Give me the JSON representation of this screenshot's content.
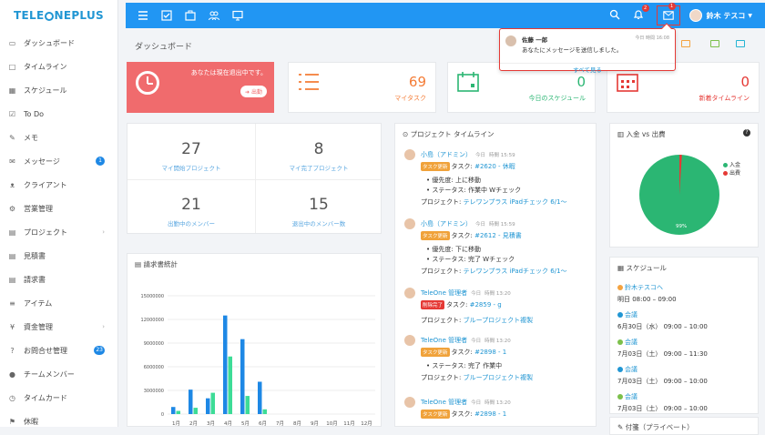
{
  "logo": {
    "text_before": "TELE",
    "text_after": "NEPLUS"
  },
  "sidebar": {
    "items": [
      {
        "label": "ダッシュボード",
        "icon": "monitor-icon"
      },
      {
        "label": "タイムライン",
        "icon": "square-icon"
      },
      {
        "label": "スケジュール",
        "icon": "calendar-icon"
      },
      {
        "label": "To Do",
        "icon": "checkbox-icon"
      },
      {
        "label": "メモ",
        "icon": "edit-icon"
      },
      {
        "label": "メッセージ",
        "icon": "envelope-icon",
        "badge": "1"
      },
      {
        "label": "クライアント",
        "icon": "handshake-icon"
      },
      {
        "label": "営業管理",
        "icon": "gears-icon"
      },
      {
        "label": "プロジェクト",
        "icon": "folder-icon",
        "chevron": true
      },
      {
        "label": "見積書",
        "icon": "document-icon"
      },
      {
        "label": "請求書",
        "icon": "invoice-icon"
      },
      {
        "label": "アイテム",
        "icon": "list-icon"
      },
      {
        "label": "資金管理",
        "icon": "yen-icon",
        "chevron": true
      },
      {
        "label": "お問合せ管理",
        "icon": "question-icon",
        "badge": "23"
      },
      {
        "label": "チームメンバー",
        "icon": "user-icon"
      },
      {
        "label": "タイムカード",
        "icon": "clock-icon"
      },
      {
        "label": "休暇",
        "icon": "leave-icon"
      }
    ]
  },
  "topbar": {
    "notif_badge": "2",
    "mail_badge": "1",
    "user_name": "鈴木 テスコ"
  },
  "page_title": "ダッシュボード",
  "away_card": {
    "text": "あなたは現在退出中です。",
    "button": "出勤"
  },
  "stats": [
    {
      "value": "69",
      "label": "マイタスク",
      "color": "#f47c36"
    },
    {
      "value": "0",
      "label": "今日のスケジュール",
      "color": "#2bb673"
    },
    {
      "value": "0",
      "label": "新着タイムライン",
      "color": "#e53935"
    }
  ],
  "counts": [
    {
      "value": "27",
      "label": "マイ開始プロジェクト"
    },
    {
      "value": "8",
      "label": "マイ完了プロジェクト"
    },
    {
      "value": "21",
      "label": "出勤中のメンバー"
    },
    {
      "value": "15",
      "label": "退出中のメンバー数"
    }
  ],
  "invoice_chart": {
    "title": "請求書統計"
  },
  "chart_data": {
    "type": "bar",
    "categories": [
      "1月",
      "2月",
      "3月",
      "4月",
      "5月",
      "6月",
      "7月",
      "8月",
      "9月",
      "10月",
      "11月",
      "12月"
    ],
    "series": [
      {
        "color": "#1e88e5",
        "values": [
          900000,
          3100000,
          2000000,
          12500000,
          9500000,
          4100000,
          0,
          0,
          0,
          0,
          0,
          0
        ]
      },
      {
        "color": "#3ddc97",
        "values": [
          400000,
          800000,
          2700000,
          7300000,
          2300000,
          600000,
          0,
          0,
          0,
          0,
          0,
          0
        ]
      }
    ],
    "yticks": [
      "0",
      "3000000",
      "6000000",
      "9000000",
      "12000000",
      "15000000"
    ],
    "ylim": [
      0,
      15000000
    ]
  },
  "timeline": {
    "title": "プロジェクト タイムライン",
    "items": [
      {
        "name": "小島（アドミン）",
        "day": "今日",
        "time": "時間 15:59",
        "tag": "タスク更新",
        "tag_color": "orange",
        "task_label": "タスク:",
        "task_link": "#2620 - 休暇",
        "bullets": [
          "優先度: 上に移動",
          "ステータス: 作業中 Wチェック"
        ],
        "project_label": "プロジェクト:",
        "project_link": "テレワンプラス iPadチェック 6/1～"
      },
      {
        "name": "小島（アドミン）",
        "day": "今日",
        "time": "時間 15:59",
        "tag": "タスク更新",
        "tag_color": "orange",
        "task_label": "タスク:",
        "task_link": "#2612 - 見積書",
        "bullets": [
          "優先度: 下に移動",
          "ステータス: 完了 Wチェック"
        ],
        "project_label": "プロジェクト:",
        "project_link": "テレワンプラス iPadチェック 6/1～"
      },
      {
        "name": "TeleOne 管理者",
        "day": "今日",
        "time": "時間 13:20",
        "tag": "削除完了",
        "tag_color": "red",
        "task_label": "タスク:",
        "task_link": "#2859 - g",
        "bullets": [],
        "project_label": "プロジェクト:",
        "project_link": "ブループロジェクト複製"
      },
      {
        "name": "TeleOne 管理者",
        "day": "今日",
        "time": "時間 13:20",
        "tag": "タスク更新",
        "tag_color": "orange",
        "task_label": "タスク:",
        "task_link": "#2898 - 1",
        "bullets": [
          "ステータス: 完了 作業中"
        ],
        "project_label": "プロジェクト:",
        "project_link": "ブループロジェクト複製"
      },
      {
        "name": "TeleOne 管理者",
        "day": "今日",
        "time": "時間 13:20",
        "tag": "タスク更新",
        "tag_color": "orange",
        "task_label": "タスク:",
        "task_link": "#2898 - 1",
        "bullets": [],
        "project_label": "",
        "project_link": ""
      }
    ]
  },
  "pie": {
    "title": "入金 vs 出費",
    "legend": [
      {
        "label": "入金",
        "color": "#2bb673"
      },
      {
        "label": "出費",
        "color": "#e53935"
      }
    ],
    "slice_label": "99%",
    "income_fraction": 0.99
  },
  "schedule": {
    "title": "スケジュール",
    "items": [
      {
        "title": "鈴木テスコへ",
        "time": "明日 08:00 – 09:00",
        "color": "#f4a340"
      },
      {
        "title": "会議",
        "time": "6月30日（水） 09:00 – 10:00",
        "color": "#2196d3"
      },
      {
        "title": "会議",
        "time": "7月03日（土） 09:00 – 11:30",
        "color": "#7cc04b"
      },
      {
        "title": "会議",
        "time": "7月03日（土） 09:00 – 10:00",
        "color": "#2196d3"
      },
      {
        "title": "会議",
        "time": "7月03日（土） 09:00 – 10:00",
        "color": "#7cc04b"
      }
    ]
  },
  "note": {
    "title": "付箋（プライベート）"
  },
  "dropdown": {
    "name": "佐藤 一郎",
    "time": "今日  時間 16:08",
    "message": "あなたにメッセージを送信しました。",
    "see_all": "すべて見る"
  }
}
